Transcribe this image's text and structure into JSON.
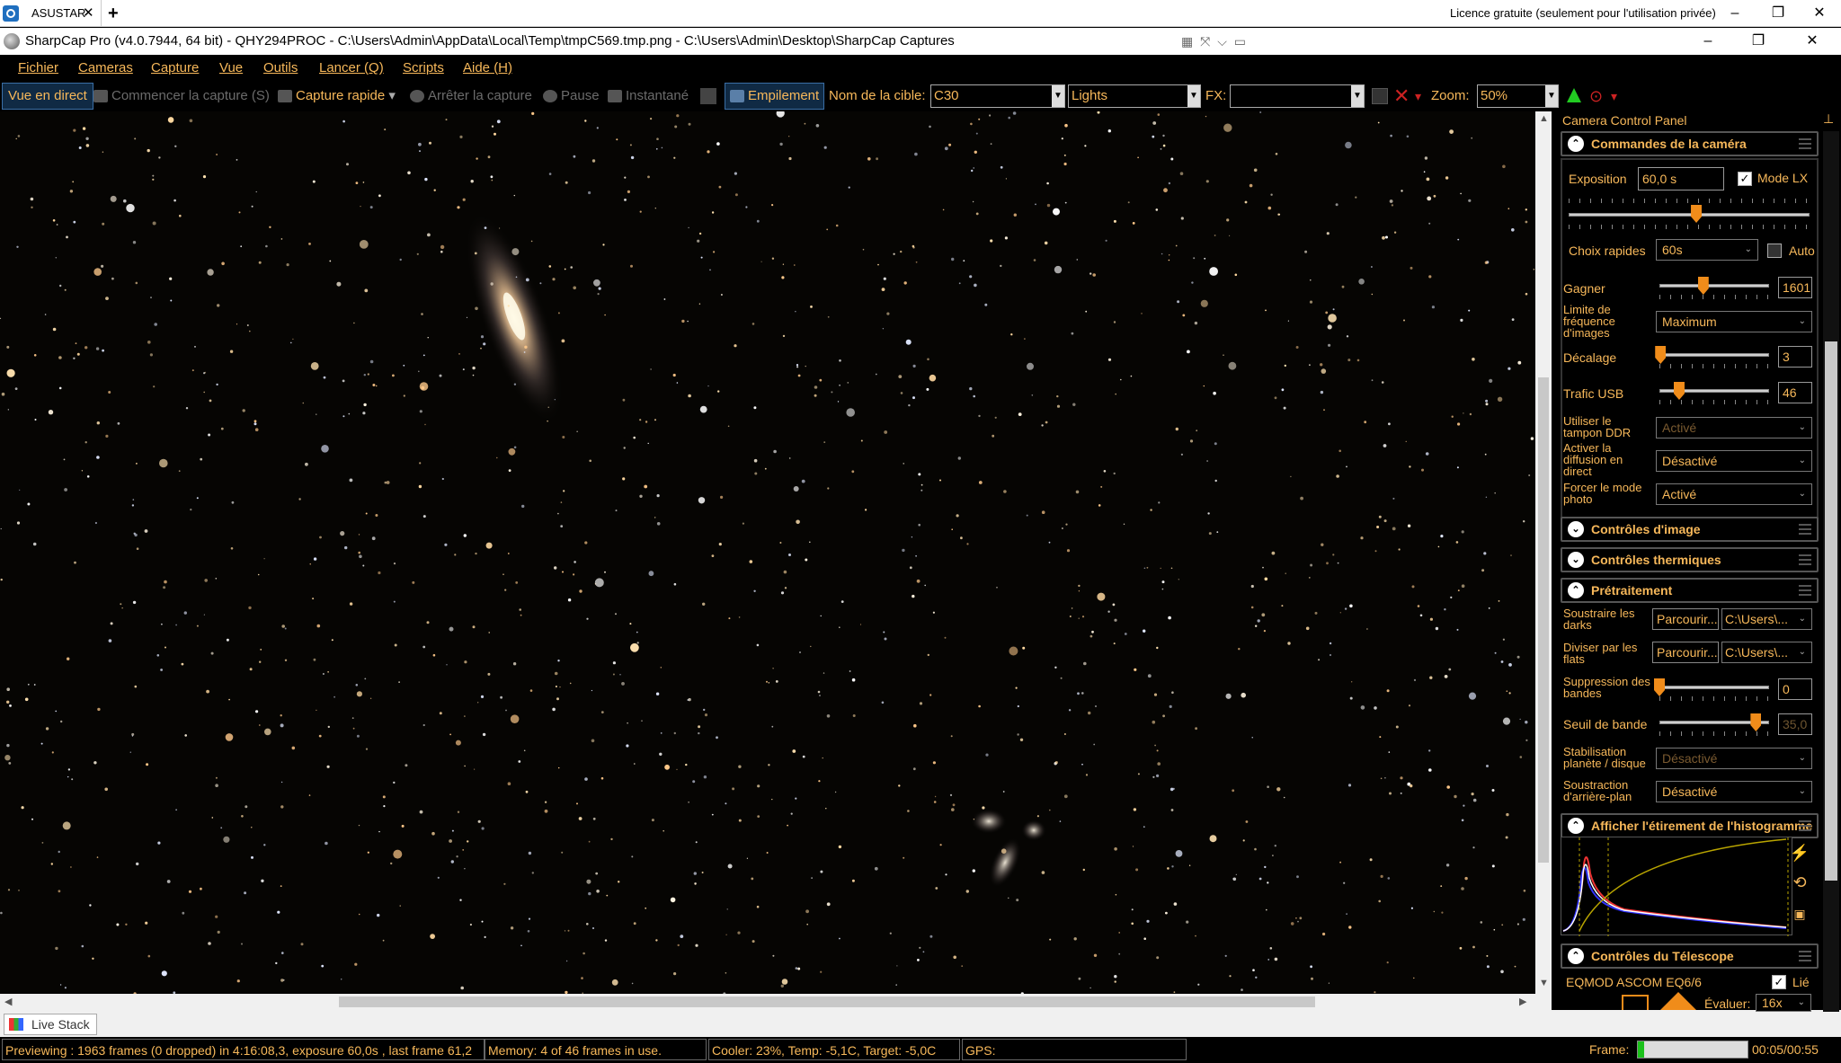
{
  "remote_desktop": {
    "tab_label": "ASUSTAR",
    "tab_close": "✕",
    "new_tab": "+",
    "license_text": "Licence gratuite (seulement pour l'utilisation privée)",
    "controls": {
      "minimize": "–",
      "maximize": "❐",
      "close": "✕"
    }
  },
  "window": {
    "title": "SharpCap Pro (v4.0.7944, 64 bit) - QHY294PROC - C:\\Users\\Admin\\AppData\\Local\\Temp\\tmpC569.tmp.png - C:\\Users\\Admin\\Desktop\\SharpCap Captures",
    "title_glyphs": "▦ ⤧ ⌵ ▭",
    "controls": {
      "minimize": "–",
      "maximize": "❐",
      "close": "✕"
    }
  },
  "menu": [
    "Fichier",
    "Cameras",
    "Capture",
    "Vue",
    "Outils",
    "Lancer (Q)",
    "Scripts",
    "Aide (H)"
  ],
  "toolbar": {
    "live_view": "Vue en direct",
    "start_capture": "Commencer la capture (S)",
    "quick_capture": "Capture rapide",
    "quick_capture_arrow": "▾",
    "stop_capture": "Arrêter la capture",
    "pause": "Pause",
    "snapshot": "Instantané",
    "stacking": "Empilement",
    "target_name_label": "Nom de la cible:",
    "target_name_value": "C30",
    "frame_type": "Lights",
    "fx_label": "FX:",
    "fx_value": "",
    "zoom_label": "Zoom:",
    "zoom_value": "50%",
    "dropdown_arrow": "▼",
    "red_arrow": "▾"
  },
  "panel": {
    "title": "Camera Control Panel",
    "pin": "⊥",
    "camera_controls": {
      "title": "Commandes de la caméra",
      "exposure_label": "Exposition",
      "exposure_value": "60,0 s",
      "mode_lx_label": "Mode LX",
      "mode_lx_checked": "✓",
      "quick_choices_label": "Choix rapides",
      "quick_choices_value": "60s",
      "auto_label": "Auto",
      "gain_label": "Gagner",
      "gain_value": "1601",
      "frame_rate_label": "Limite de fréquence d'images",
      "frame_rate_value": "Maximum",
      "offset_label": "Décalage",
      "offset_value": "3",
      "usb_label": "Trafic USB",
      "usb_value": "46",
      "ddr_label": "Utiliser le tampon DDR",
      "ddr_value": "Activé",
      "live_stream_label": "Activer la diffusion en direct",
      "live_stream_value": "Désactivé",
      "photo_mode_label": "Forcer le mode photo",
      "photo_mode_value": "Activé"
    },
    "image_controls": {
      "title": "Contrôles d'image"
    },
    "thermal_controls": {
      "title": "Contrôles thermiques"
    },
    "preprocessing": {
      "title": "Prétraitement",
      "darks_label": "Soustraire les darks",
      "darks_button": "Parcourir...",
      "darks_path": "C:\\Users\\...",
      "flats_label": "Diviser par les flats",
      "flats_button": "Parcourir...",
      "flats_path": "C:\\Users\\...",
      "banding_label": "Suppression des bandes",
      "banding_value": "0",
      "band_threshold_label": "Seuil de bande",
      "band_threshold_value": "35,0",
      "stabilization_label": "Stabilisation planète / disque",
      "stabilization_value": "Désactivé",
      "background_label": "Soustraction d'arrière-plan",
      "background_value": "Désactivé"
    },
    "histogram": {
      "title": "Afficher l'étirement de l'histogramme"
    },
    "telescope": {
      "title": "Contrôles du Télescope",
      "mount": "EQMOD ASCOM EQ6/6",
      "linked_label": "Lié",
      "linked_checked": "✓",
      "rate_label": "Évaluer:",
      "rate_value": "16x"
    },
    "chevron_up": "⌃",
    "chevron_down": "⌄",
    "dd_arrow": "⌄"
  },
  "bottom": {
    "live_stack_tab": "Live Stack"
  },
  "status": {
    "preview": "Previewing : 1963 frames (0 dropped) in 4:16:08,3, exposure 60,0s , last frame 61,2",
    "memory": "Memory: 4 of 46 frames in use.",
    "cooler": "Cooler: 23%, Temp: -5,1C, Target: -5,0C",
    "gps": "GPS:",
    "frame_label": "Frame:",
    "frame_progress": 0.06,
    "frame_time": "00:05/00:55"
  },
  "slider_levels": {
    "exposure": 0.53,
    "gain": 0.4,
    "offset": 0.01,
    "usb": 0.18,
    "banding": 0.0,
    "band_threshold": 0.88
  },
  "colors": {
    "accent": "#f7b85a",
    "slider_thumb": "#f08c1a",
    "progress": "#1bc11b"
  }
}
